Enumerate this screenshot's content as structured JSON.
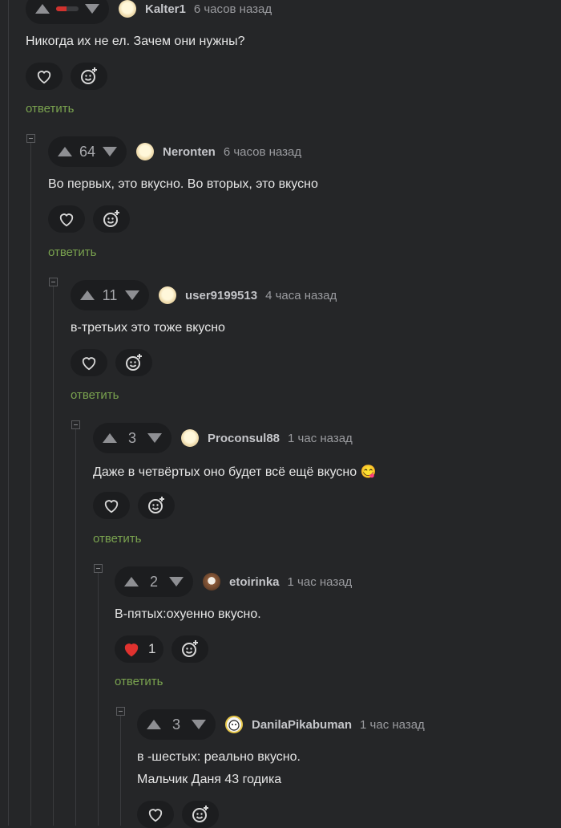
{
  "reply_label": "ответить",
  "colors": {
    "background": "#252628",
    "reply": "#7aa34f",
    "heart_active": "#e0322f",
    "rating_negative": "#d0322e"
  },
  "icons": {
    "upvote": "arrow-up-icon",
    "downvote": "arrow-down-icon",
    "like": "heart-icon",
    "react": "emoji-add-icon",
    "collapse": "collapse-minus-icon"
  },
  "comments": [
    {
      "author": "Kalter1",
      "time": "6 часов назад",
      "rating": "",
      "rating_fraction_negative": 0.45,
      "lines": [
        "Никогда их не ел. Зачем они нужны?"
      ],
      "likes": "",
      "liked": false
    },
    {
      "author": "Neronten",
      "time": "6 часов назад",
      "rating": "64",
      "lines": [
        "Во первых, это вкусно. Во вторых, это вкусно"
      ],
      "likes": "",
      "liked": false
    },
    {
      "author": "user9199513",
      "time": "4 часа назад",
      "rating": "11",
      "lines": [
        "в-третьих это тоже вкусно"
      ],
      "likes": "",
      "liked": false
    },
    {
      "author": "Proconsul88",
      "time": "1 час назад",
      "rating": "3",
      "lines": [
        "Даже в четвёртых оно будет всё ещё вкусно 😋"
      ],
      "likes": "",
      "liked": false
    },
    {
      "author": "etoirinka",
      "time": "1 час назад",
      "rating": "2",
      "lines": [
        "В-пятых:охуенно вкусно."
      ],
      "likes": "1",
      "liked": true
    },
    {
      "author": "DanilaPikabuman",
      "time": "1 час назад",
      "rating": "3",
      "lines": [
        "в -шестых: реально вкусно.",
        "Мальчик Даня 43 годика"
      ],
      "likes": "",
      "liked": false
    }
  ]
}
